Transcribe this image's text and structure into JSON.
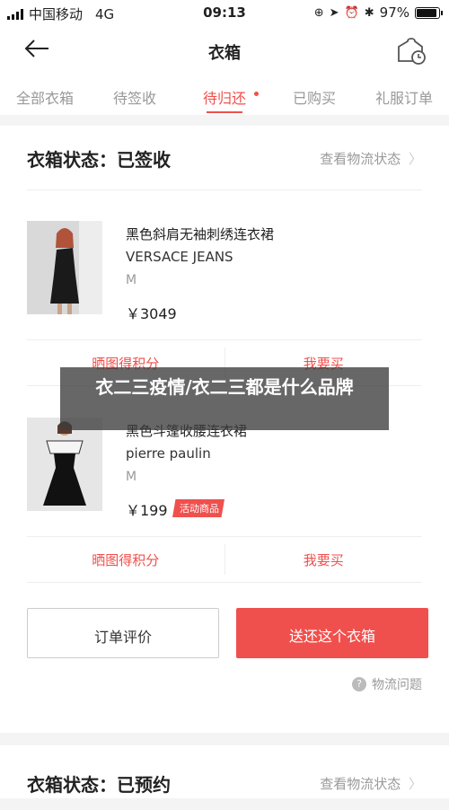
{
  "status_bar": {
    "carrier": "中国移动",
    "network": "4G",
    "time": "09:13",
    "battery": "97%"
  },
  "nav": {
    "title": "衣箱"
  },
  "tabs": [
    {
      "label": "全部衣箱"
    },
    {
      "label": "待签收"
    },
    {
      "label": "待归还"
    },
    {
      "label": "已购买"
    },
    {
      "label": "礼服订单"
    }
  ],
  "box1": {
    "status": "衣箱状态：已签收",
    "track_label": "查看物流状态",
    "items": [
      {
        "name": "黑色斜肩无袖刺绣连衣裙",
        "brand": "VERSACE JEANS",
        "size": "M",
        "price": "￥3049",
        "left_action": "晒图得积分",
        "right_action": "我要买"
      },
      {
        "name": "黑色斗篷收腰连衣裙",
        "brand": "pierre paulin",
        "size": "M",
        "price": "￥199",
        "tag": "活动商品",
        "left_action": "晒图得积分",
        "right_action": "我要买"
      }
    ],
    "review_button": "订单评价",
    "return_button": "送还这个衣箱",
    "logistics_question": "物流问题"
  },
  "box2": {
    "status": "衣箱状态：已预约",
    "track_label": "查看物流状态"
  },
  "overlay": {
    "text": "衣二三疫情/衣二三都是什么品牌"
  },
  "colors": {
    "accent": "#f0504d"
  }
}
